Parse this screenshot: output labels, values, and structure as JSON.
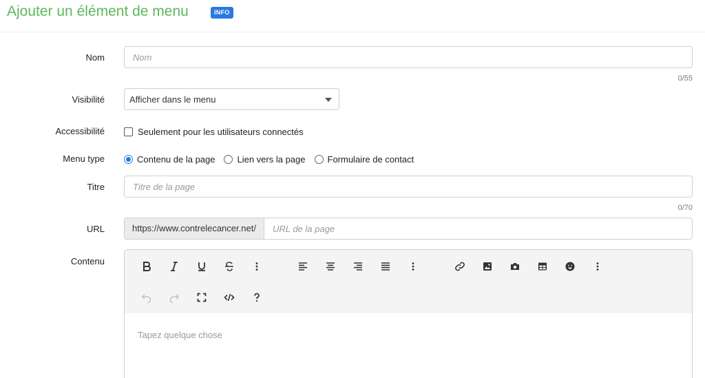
{
  "header": {
    "title": "Ajouter un élément de menu",
    "badge": "INFO"
  },
  "form": {
    "name": {
      "label": "Nom",
      "placeholder": "Nom",
      "counter": "0/55"
    },
    "visibility": {
      "label": "Visibilité",
      "selected": "Afficher dans le menu"
    },
    "accessibility": {
      "label": "Accessibilité",
      "checkbox_label": "Seulement pour les utilisateurs connectés",
      "checked": false
    },
    "menu_type": {
      "label": "Menu type",
      "options": [
        "Contenu de la page",
        "Lien vers la page",
        "Formulaire de contact"
      ],
      "selected_index": 0
    },
    "title": {
      "label": "Titre",
      "placeholder": "Titre de la page",
      "counter": "0/70"
    },
    "url": {
      "label": "URL",
      "prefix": "https://www.contrelecancer.net/",
      "placeholder": "URL de la page"
    },
    "content": {
      "label": "Contenu",
      "placeholder": "Tapez quelque chose"
    }
  },
  "toolbar_icons": {
    "row1": [
      "bold-icon",
      "italic-icon",
      "underline-icon",
      "strikethrough-icon",
      "more-vertical-icon",
      "align-left-icon",
      "align-center-icon",
      "align-right-icon",
      "align-justify-icon",
      "more-vertical-icon",
      "link-icon",
      "image-icon",
      "camera-icon",
      "table-icon",
      "emoji-icon",
      "more-vertical-icon"
    ],
    "row2": [
      "undo-icon",
      "redo-icon",
      "fullscreen-icon",
      "code-view-icon",
      "help-icon"
    ]
  },
  "colors": {
    "title_green": "#5cb85c",
    "badge_blue": "#2a78e4",
    "toolbar_bg": "#f4f4f4"
  }
}
